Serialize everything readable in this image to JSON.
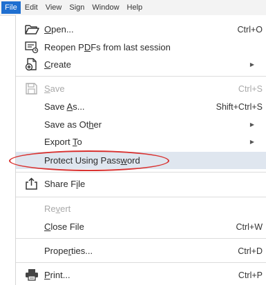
{
  "menubar": {
    "items": [
      "File",
      "Edit",
      "View",
      "Sign",
      "Window",
      "Help"
    ]
  },
  "menu": {
    "items": [
      {
        "label_pre": "",
        "label_u": "O",
        "label_post": "pen...",
        "shortcut": "Ctrl+O",
        "icon": "folder-open-icon"
      },
      {
        "label_pre": "Reopen P",
        "label_u": "D",
        "label_post": "Fs from last session",
        "shortcut": "",
        "icon": "reopen-pdfs-icon"
      },
      {
        "label_pre": "",
        "label_u": "C",
        "label_post": "reate",
        "shortcut": "",
        "icon": "create-pdf-icon",
        "submenu": true
      },
      {
        "label_pre": "",
        "label_u": "S",
        "label_post": "ave",
        "shortcut": "Ctrl+S",
        "icon": "save-icon",
        "disabled": true
      },
      {
        "label_pre": "Save ",
        "label_u": "A",
        "label_post": "s...",
        "shortcut": "Shift+Ctrl+S"
      },
      {
        "label_pre": "Save as Ot",
        "label_u": "h",
        "label_post": "er",
        "shortcut": "",
        "submenu": true
      },
      {
        "label_pre": "Export ",
        "label_u": "T",
        "label_post": "o",
        "shortcut": "",
        "submenu": true
      },
      {
        "label_pre": "Protect Using Pass",
        "label_u": "w",
        "label_post": "ord",
        "shortcut": "",
        "highlight": true
      },
      {
        "label_pre": "Share F",
        "label_u": "i",
        "label_post": "le",
        "shortcut": "",
        "icon": "share-icon"
      },
      {
        "label_pre": "Re",
        "label_u": "v",
        "label_post": "ert",
        "shortcut": "",
        "disabled": true
      },
      {
        "label_pre": "",
        "label_u": "C",
        "label_post": "lose File",
        "shortcut": "Ctrl+W"
      },
      {
        "label_pre": "Prope",
        "label_u": "r",
        "label_post": "ties...",
        "shortcut": "Ctrl+D"
      },
      {
        "label_pre": "",
        "label_u": "P",
        "label_post": "rint...",
        "shortcut": "Ctrl+P",
        "icon": "printer-icon"
      }
    ]
  },
  "colors": {
    "menubar_active": "#1f6fd0",
    "highlight_row": "#dfe6ef",
    "annotation_circle": "#d9312f",
    "disabled_text": "#a9a9a9"
  }
}
